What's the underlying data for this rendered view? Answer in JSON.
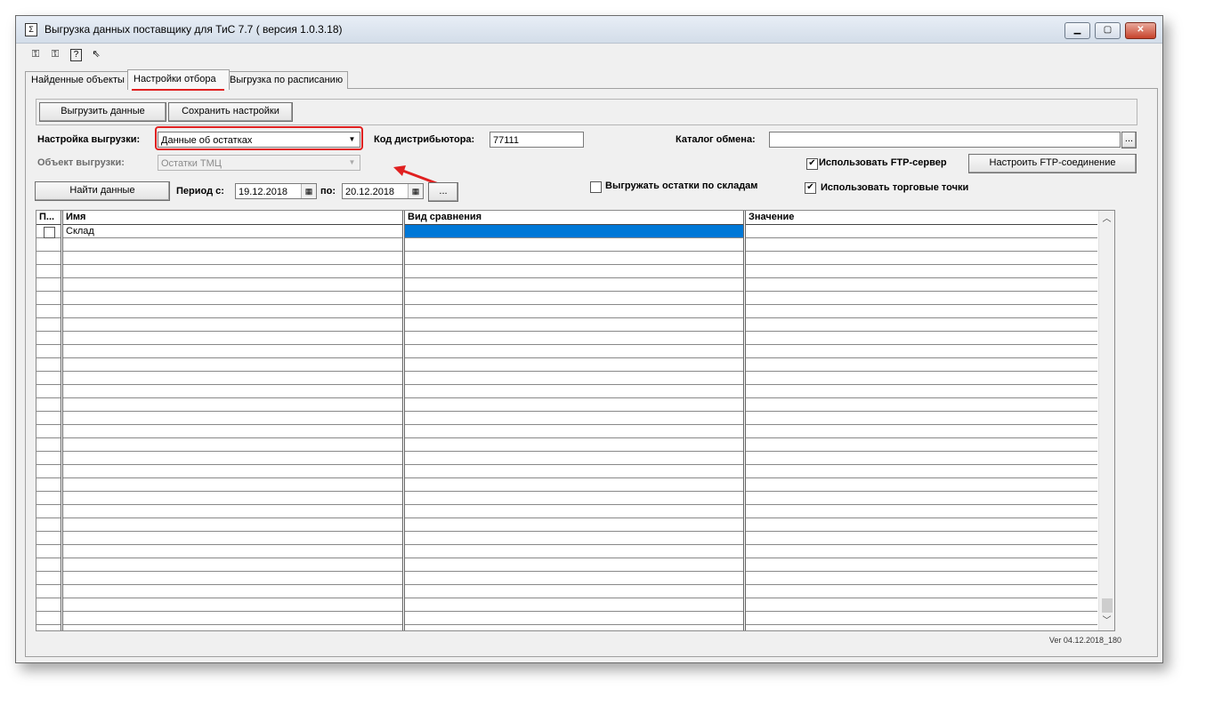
{
  "window": {
    "title": "Выгрузка данных поставщику для ТиС 7.7 ( версия 1.0.3.18)",
    "minimize_icon": "minimize-icon",
    "maximize_icon": "maximize-icon",
    "close_icon": "close-icon"
  },
  "toolbar": {
    "icons": [
      "connect-icon",
      "disconnect-icon",
      "help-icon",
      "context-help-icon"
    ]
  },
  "tabs": [
    {
      "label": "Найденные объекты",
      "active": false
    },
    {
      "label": "Настройки отбора",
      "active": true
    },
    {
      "label": "Выгрузка по расписанию",
      "active": false
    }
  ],
  "actions": {
    "export_label": "Выгрузить данные",
    "save_label": "Сохранить настройки",
    "find_label": "Найти данные",
    "more_label": "...",
    "browse_label": "...",
    "ftp_setup_label": "Настроить FTP-соединение"
  },
  "form": {
    "export_setting_label": "Настройка выгрузки:",
    "export_setting_value": "Данные об остатках",
    "export_object_label": "Объект выгрузки:",
    "export_object_value": "Остатки ТМЦ",
    "distributor_code_label": "Код дистрибьютора:",
    "distributor_code_value": "77111",
    "exchange_catalog_label": "Каталог обмена:",
    "exchange_catalog_value": "",
    "period_from_label": "Период с:",
    "period_from_value": "19.12.2018",
    "period_to_label": "по:",
    "period_to_value": "20.12.2018",
    "use_ftp_label": "Использовать FTP-сервер",
    "use_ftp_checked": true,
    "export_by_warehouse_label": "Выгружать остатки по складам",
    "export_by_warehouse_checked": false,
    "use_outlets_label": "Использовать торговые точки",
    "use_outlets_checked": true
  },
  "grid": {
    "columns": [
      "П...",
      "Имя",
      "Вид сравнения",
      "Значение"
    ],
    "rows": [
      {
        "checked": false,
        "name": "Склад",
        "compare": "",
        "value": ""
      }
    ]
  },
  "status": {
    "version": "Ver 04.12.2018_180"
  },
  "colors": {
    "highlight": "#e02020",
    "selection": "#0078d7",
    "window_bg": "#f0f0f0"
  }
}
